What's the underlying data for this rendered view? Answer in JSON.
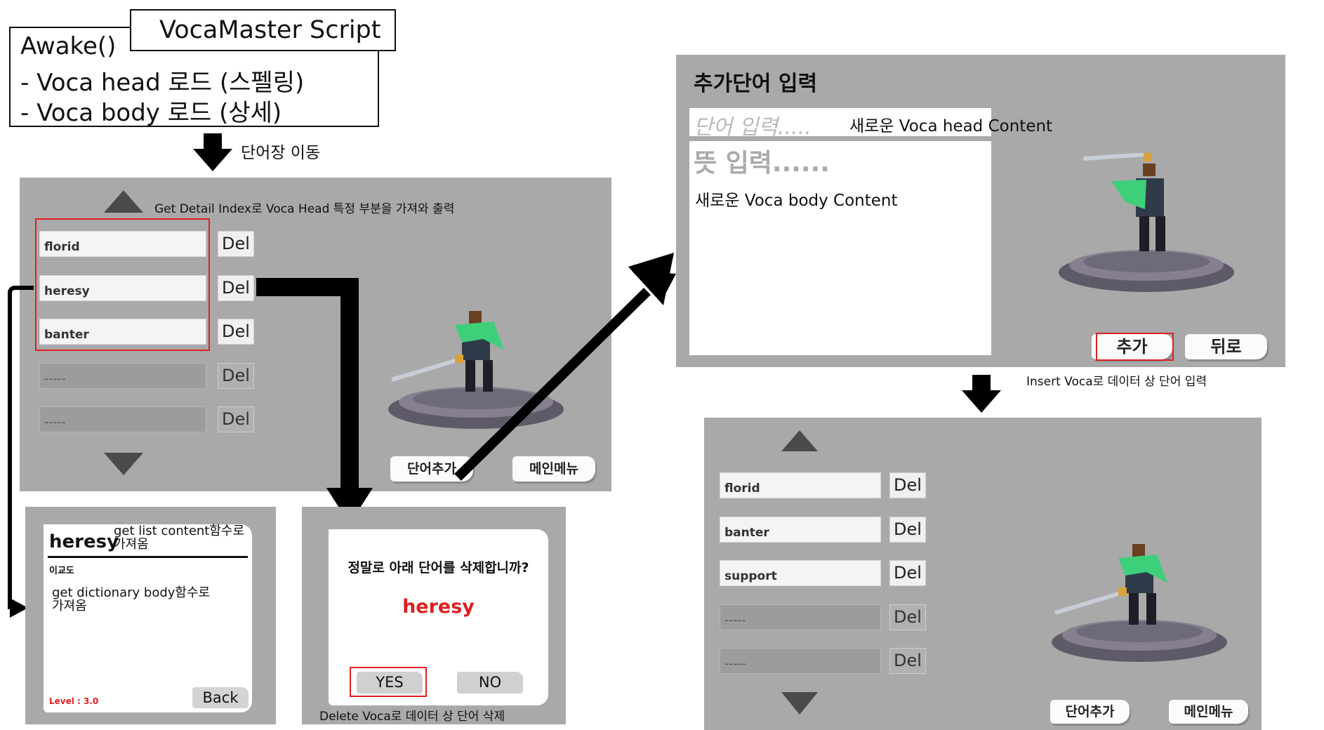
{
  "script_box": {
    "title": "VocaMaster Script",
    "awake": "Awake()",
    "line1": "-   Voca head 로드 (스펠링)",
    "line2": "-   Voca body 로드 (상세)"
  },
  "arrow_label_vocab": "단어장 이동",
  "list_panel": {
    "annotation": "Get Detail Index로 Voca Head 특정 부분을 가져와 출력",
    "words": [
      "florid",
      "heresy",
      "banter",
      "-----",
      "-----"
    ],
    "del_label": "Del",
    "add_button": "단어추가",
    "menu_button": "메인메뉴"
  },
  "detail_panel": {
    "word": "heresy",
    "head_note": "get list content함수로 가져옴",
    "meaning": "이교도",
    "body_note": "get dictionary body함수로 가져옴",
    "level": "Level : 3.0",
    "back": "Back"
  },
  "delete_panel": {
    "question": "정말로 아래 단어를 삭제합니까?",
    "word": "heresy",
    "yes": "YES",
    "no": "NO",
    "annotation": "Delete Voca로 데이터 상 단어 삭제"
  },
  "add_panel": {
    "title": "추가단어 입력",
    "word_placeholder": "단어 입력.....",
    "head_content": "새로운 Voca head Content",
    "meaning_placeholder": "뜻 입력......",
    "body_content": "새로운 Voca body Content",
    "add": "추가",
    "back": "뒤로",
    "annotation": "Insert Voca로 데이터 상 단어 입력"
  },
  "result_panel": {
    "words": [
      "florid",
      "banter",
      "support",
      "-----",
      "-----"
    ],
    "del_label": "Del",
    "add_button": "단어추가",
    "menu_button": "메인메뉴"
  },
  "colors": {
    "panel": "#a9a9a9",
    "highlight": "#e02020",
    "word_red": "#e02020"
  }
}
